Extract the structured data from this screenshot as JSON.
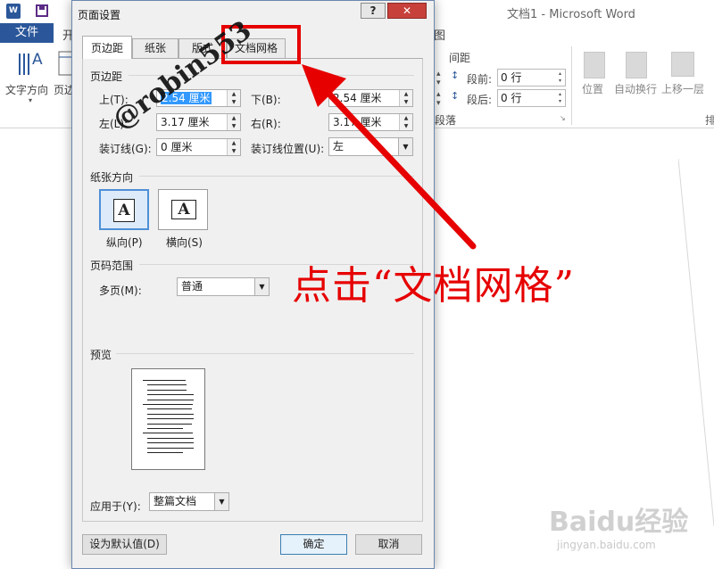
{
  "word": {
    "app_icon": "W",
    "doc_title": "文档1 - Microsoft Word",
    "file_tab": "文件",
    "tab_frag_left": "开",
    "tab_frag_right": "图",
    "ribbon": {
      "text_direction": "文字方向",
      "margins_frag": "页边",
      "spacing_header": "间距",
      "before_label": "段前:",
      "before_value": "0 行",
      "after_label": "段后:",
      "after_value": "0 行",
      "paragraph_group": "段落",
      "position": "位置",
      "wrap": "自动换行",
      "bring_forward": "上移一层",
      "arrange_frag": "排"
    }
  },
  "dialog": {
    "title": "页面设置",
    "help": "?",
    "close": "✕",
    "tabs": [
      "页边距",
      "纸张",
      "版式",
      "文档网格"
    ],
    "margins_section": "页边距",
    "top_label": "上(T):",
    "top_value": "2.54 厘米",
    "bottom_label": "下(B):",
    "bottom_value": "2.54 厘米",
    "left_label": "左(L):",
    "left_value": "3.17 厘米",
    "right_label": "右(R):",
    "right_value": "3.17 厘米",
    "gutter_label": "装订线(G):",
    "gutter_value": "0 厘米",
    "gutter_pos_label": "装订线位置(U):",
    "gutter_pos_value": "左",
    "orientation_section": "纸张方向",
    "portrait": "纵向(P)",
    "landscape": "横向(S)",
    "orient_glyph": "A",
    "pages_section": "页码范围",
    "multiple_pages_label": "多页(M):",
    "multiple_pages_value": "普通",
    "preview_section": "预览",
    "apply_to_label": "应用于(Y):",
    "apply_to_value": "整篇文档",
    "set_default": "设为默认值(D)",
    "ok": "确定",
    "cancel": "取消"
  },
  "annotation": {
    "callout": "点击“文档网格”",
    "watermark": "@robin553",
    "baidu_logo": "Baidu经验",
    "baidu_url": "jingyan.baidu.com"
  },
  "colors": {
    "accent": "#2b579a",
    "highlight": "#e60000",
    "selection": "#3399ff"
  }
}
